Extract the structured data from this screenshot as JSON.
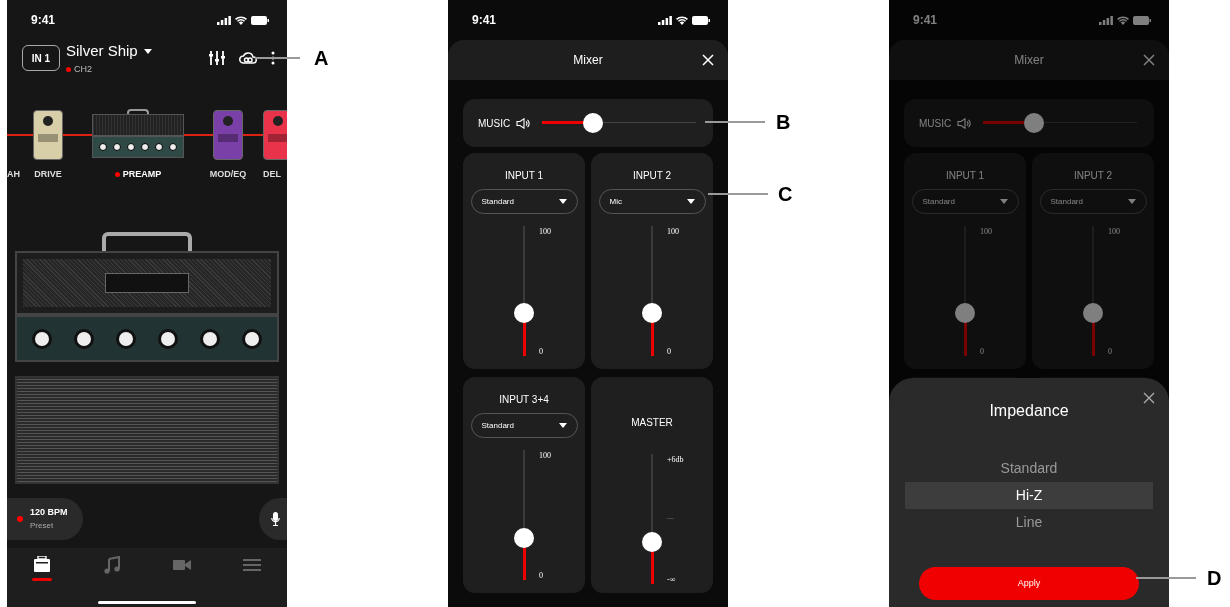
{
  "home_screen": {
    "status_bar": {
      "time": "9:41"
    },
    "input_badge": "IN 1",
    "preset_name": "Silver Ship",
    "channel": "CH2",
    "signal_chain": [
      {
        "kind": "pedal",
        "label": "AH",
        "selected": false
      },
      {
        "kind": "pedal",
        "label": "DRIVE",
        "selected": false,
        "color": "#d8cfa8"
      },
      {
        "kind": "amp_head",
        "label": "PREAMP",
        "selected": true
      },
      {
        "kind": "pedal",
        "label": "MOD/EQ",
        "selected": false,
        "color": "#7b3fa8"
      },
      {
        "kind": "pedal",
        "label": "DEL",
        "selected": false,
        "color": "#e8334a"
      }
    ],
    "tempo": {
      "bpm": "120 BPM",
      "label": "Preset"
    },
    "tabs": [
      {
        "kind": "amp",
        "selected": true
      },
      {
        "kind": "music",
        "selected": false
      },
      {
        "kind": "video",
        "selected": false
      },
      {
        "kind": "menu",
        "selected": false
      }
    ]
  },
  "mixer_screen": {
    "status_bar": {
      "time": "9:41"
    },
    "title": "Mixer",
    "music": {
      "label": "MUSIC",
      "level": 0.33
    },
    "channels": [
      {
        "name": "INPUT 1",
        "mode": "Standard",
        "max": "100",
        "min": "0",
        "level": 0.33
      },
      {
        "name": "INPUT 2",
        "mode": "Mic",
        "max": "100",
        "min": "0",
        "level": 0.33
      },
      {
        "name": "INPUT 3+4",
        "mode": "Standard",
        "max": "100",
        "min": "0",
        "level": 0.32
      },
      {
        "name": "MASTER",
        "max": "+6db",
        "min": "-∞",
        "level": 0.32
      }
    ]
  },
  "impedance_screen": {
    "status_bar": {
      "time": "9:41"
    },
    "title": "Mixer",
    "music": {
      "label": "MUSIC",
      "level": 0.33
    },
    "channels": [
      {
        "name": "INPUT 1",
        "mode": "Standard",
        "max": "100",
        "min": "0",
        "level": 0.33
      },
      {
        "name": "INPUT 2",
        "mode": "Standard",
        "max": "100",
        "min": "0",
        "level": 0.33
      }
    ],
    "sheet": {
      "title": "Impedance",
      "options": [
        {
          "label": "Standard",
          "selected": false
        },
        {
          "label": "Hi-Z",
          "selected": true
        },
        {
          "label": "Line",
          "selected": false
        }
      ],
      "apply": "Apply"
    }
  },
  "callouts": [
    {
      "label": "A"
    },
    {
      "label": "B"
    },
    {
      "label": "C"
    },
    {
      "label": "D"
    }
  ]
}
